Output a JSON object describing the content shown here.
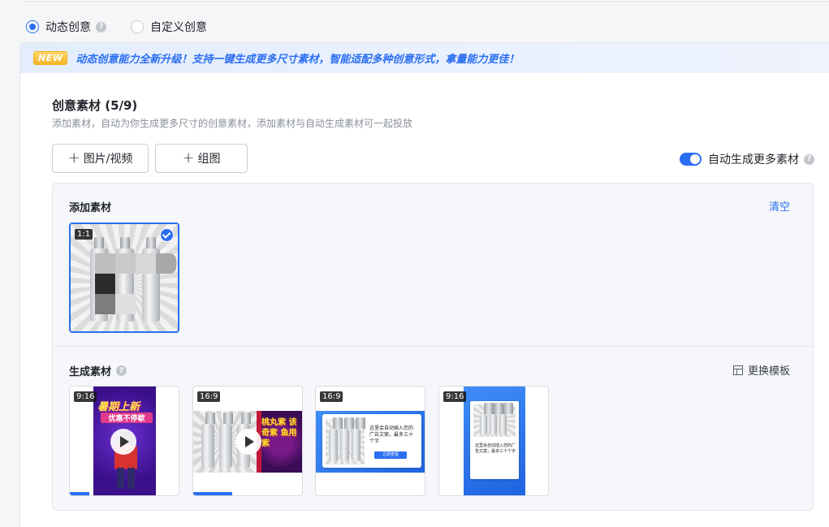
{
  "mode": {
    "dynamic_label": "动态创意",
    "custom_label": "自定义创意",
    "help": "?"
  },
  "banner": {
    "badge": "NEW",
    "text": "动态创意能力全新升级！支持一键生成更多尺寸素材，智能适配多种创意形式，拿量能力更佳！"
  },
  "section": {
    "title": "创意素材 (5/9)",
    "desc": "添加素材，自动为你生成更多尺寸的创意素材，添加素材与自动生成素材可一起投放",
    "add_media_label": "图片/视频",
    "add_group_label": "组图",
    "plus": "+",
    "auto_gen_label": "自动生成更多素材",
    "auto_gen_on": true
  },
  "added": {
    "title": "添加素材",
    "clear": "清空",
    "items": [
      {
        "ratio": "1:1",
        "selected": true
      }
    ]
  },
  "generated": {
    "title": "生成素材",
    "replace_template": "更换模板",
    "items": [
      {
        "ratio": "9:16",
        "headline": "暑期上新",
        "sub": "优惠不停歇"
      },
      {
        "ratio": "16:9",
        "tag": "桃丸紫 该奇紫 鱼用紫"
      },
      {
        "ratio": "16:9",
        "ad_text": "这里会自动插入您的广告文案，最多三十个字",
        "cta": "立即查看"
      },
      {
        "ratio": "9:16",
        "ad_text": "这里会自动插入您的广告文案，最多三十个字"
      }
    ]
  },
  "colors": {
    "accent": "#2a6ef2",
    "badge": "#f5b526"
  }
}
